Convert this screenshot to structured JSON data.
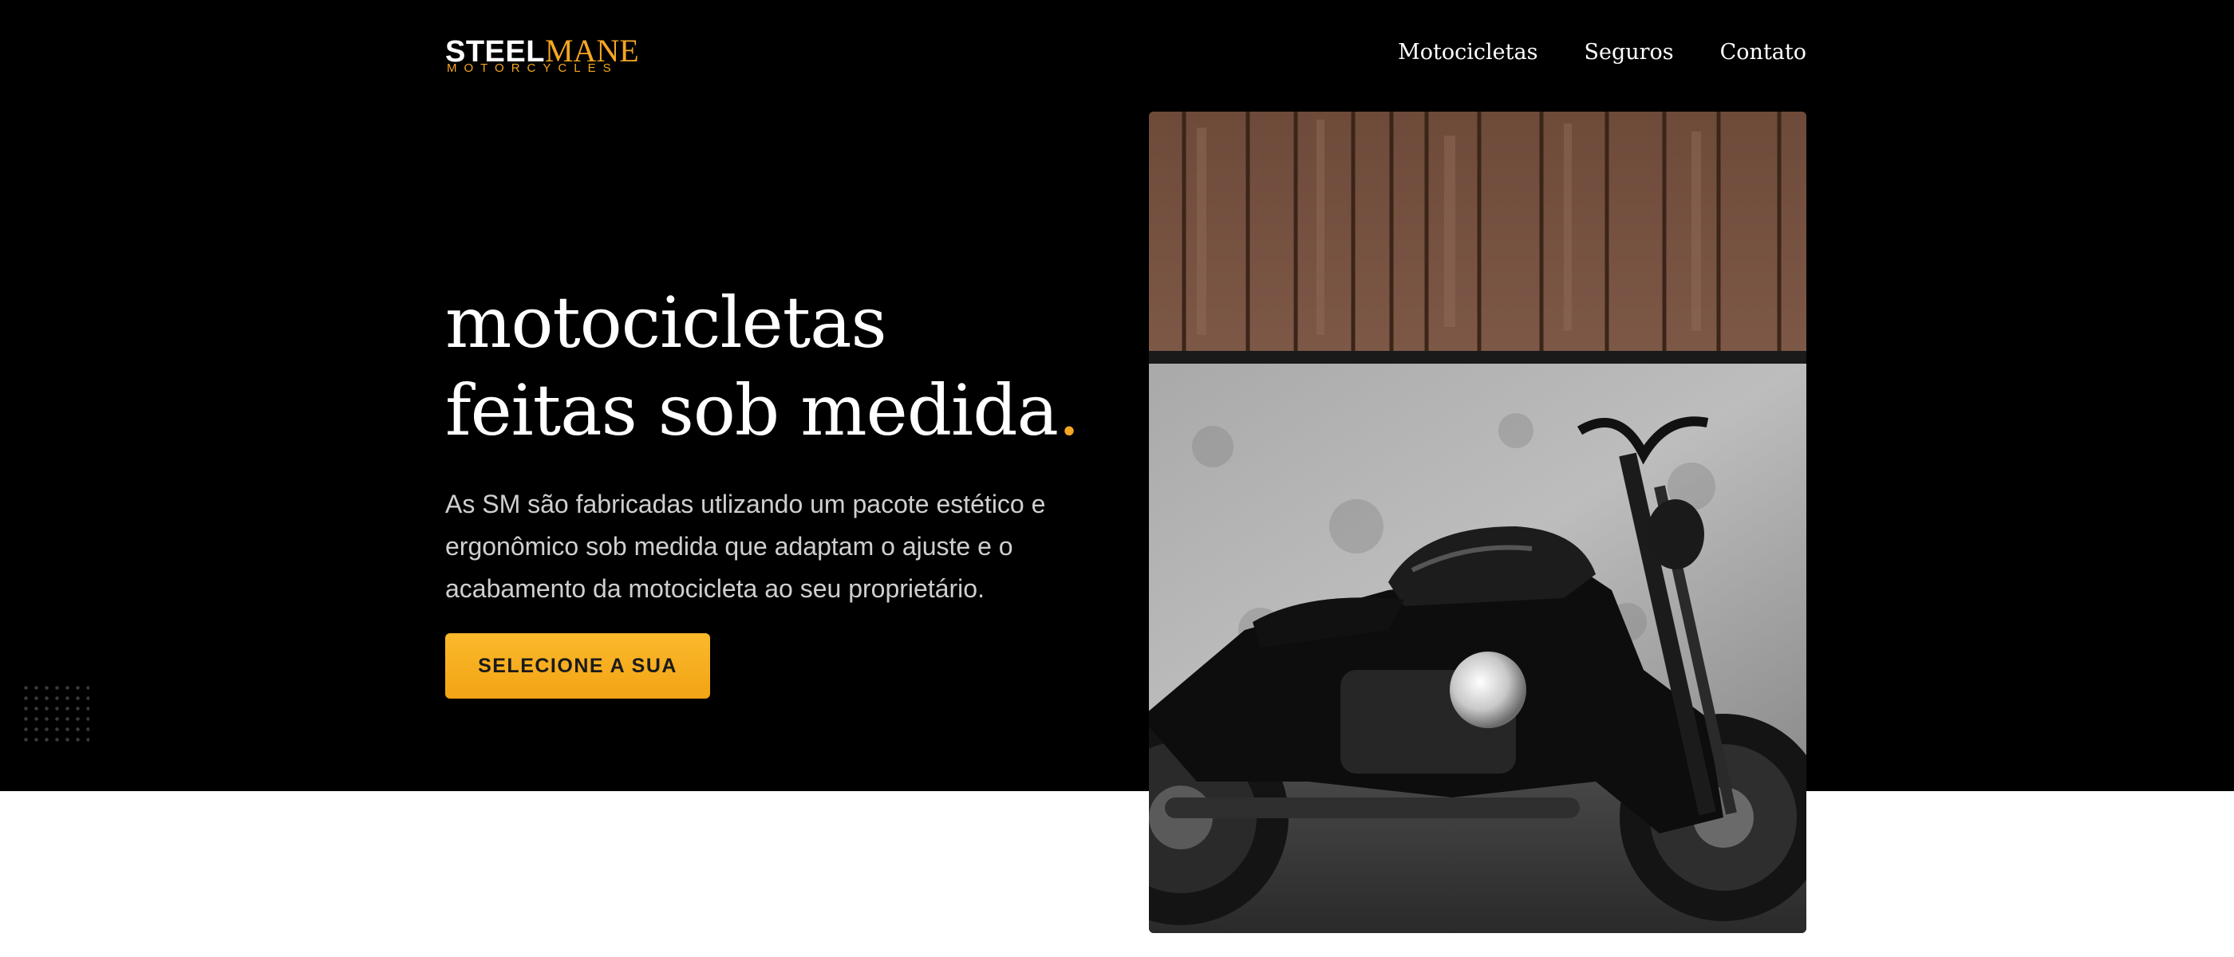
{
  "brand": {
    "name_part1": "STEEL",
    "name_part2": "MANE",
    "tagline": "MOTORCYCLES"
  },
  "nav": {
    "items": [
      "Motocicletas",
      "Seguros",
      "Contato"
    ]
  },
  "hero": {
    "headline_line1": "motocicletas",
    "headline_line2": "feitas sob medida",
    "headline_dot": ".",
    "description": "As SM são fabricadas utlizando um pacote estético e ergonômico sob medida que adaptam o ajuste e o acabamento da motocicleta ao seu proprietário.",
    "cta_label": "SELECIONE A SUA"
  },
  "colors": {
    "accent": "#f5a623",
    "background": "#000000",
    "text": "#ffffff"
  },
  "image": {
    "subject": "motorcycle-photo"
  }
}
